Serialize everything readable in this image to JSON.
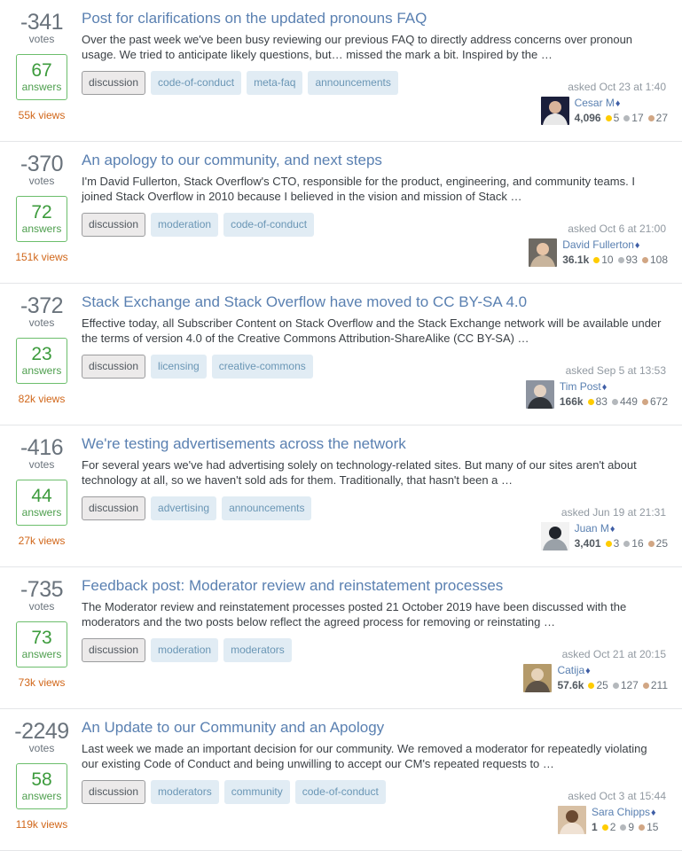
{
  "labels": {
    "votes": "votes",
    "answers": "answers",
    "asked_prefix": "asked",
    "mod_diamond": "♦"
  },
  "questions": [
    {
      "votes": "-341",
      "answers": "67",
      "views": "55k views",
      "title": "Post for clarifications on the updated pronouns FAQ",
      "excerpt": "Over the past week we've been busy reviewing our previous FAQ to directly address concerns over pronoun usage. We tried to anticipate likely questions, but… missed the mark a bit. Inspired by the …",
      "tags": [
        {
          "name": "discussion",
          "style": "required"
        },
        {
          "name": "code-of-conduct",
          "style": "normal"
        },
        {
          "name": "meta-faq",
          "style": "normal"
        },
        {
          "name": "announcements",
          "style": "normal"
        }
      ],
      "asked": "asked Oct 23 at 1:40",
      "user": {
        "name": "Cesar M",
        "moderator": true,
        "reputation": "4,096",
        "gold": "5",
        "silver": "17",
        "bronze": "27",
        "avatar_colors": [
          "#1b1f3b",
          "#d9b49b",
          "#e8e8e8"
        ]
      }
    },
    {
      "votes": "-370",
      "answers": "72",
      "views": "151k views",
      "title": "An apology to our community, and next steps",
      "excerpt": "I'm David Fullerton, Stack Overflow's CTO, responsible for the product, engineering, and community teams. I joined Stack Overflow in 2010 because I believed in the vision and mission of Stack …",
      "tags": [
        {
          "name": "discussion",
          "style": "required"
        },
        {
          "name": "moderation",
          "style": "normal"
        },
        {
          "name": "code-of-conduct",
          "style": "normal"
        }
      ],
      "asked": "asked Oct 6 at 21:00",
      "user": {
        "name": "David Fullerton",
        "moderator": true,
        "reputation": "36.1k",
        "gold": "10",
        "silver": "93",
        "bronze": "108",
        "avatar_colors": [
          "#6e6a63",
          "#e7c4a6",
          "#c8b49c"
        ]
      }
    },
    {
      "votes": "-372",
      "answers": "23",
      "views": "82k views",
      "title": "Stack Exchange and Stack Overflow have moved to CC BY-SA 4.0",
      "excerpt": "Effective today, all Subscriber Content on Stack Overflow and the Stack Exchange network will be available under the terms of version 4.0 of the Creative Commons Attribution-ShareAlike (CC BY-SA) …",
      "tags": [
        {
          "name": "discussion",
          "style": "required"
        },
        {
          "name": "licensing",
          "style": "normal"
        },
        {
          "name": "creative-commons",
          "style": "normal"
        }
      ],
      "asked": "asked Sep 5 at 13:53",
      "user": {
        "name": "Tim Post",
        "moderator": true,
        "reputation": "166k",
        "gold": "83",
        "silver": "449",
        "bronze": "672",
        "avatar_colors": [
          "#8d94a0",
          "#e4d2c2",
          "#2f3338"
        ]
      }
    },
    {
      "votes": "-416",
      "answers": "44",
      "views": "27k views",
      "title": "We're testing advertisements across the network",
      "excerpt": "For several years we've had advertising solely on technology-related sites. But many of our sites aren't about technology at all, so we haven't sold ads for them. Traditionally, that hasn't been a …",
      "tags": [
        {
          "name": "discussion",
          "style": "required"
        },
        {
          "name": "advertising",
          "style": "normal"
        },
        {
          "name": "announcements",
          "style": "normal"
        }
      ],
      "asked": "asked Jun 19 at 21:31",
      "user": {
        "name": "Juan M",
        "moderator": true,
        "reputation": "3,401",
        "gold": "3",
        "silver": "16",
        "bronze": "25",
        "avatar_colors": [
          "#f2f2f2",
          "#20242b",
          "#9aa1a8"
        ]
      }
    },
    {
      "votes": "-735",
      "answers": "73",
      "views": "73k views",
      "title": "Feedback post: Moderator review and reinstatement processes",
      "excerpt": "The Moderator review and reinstatement processes posted 21 October 2019 have been discussed with the moderators and the two posts below reflect the agreed process for removing or reinstating …",
      "tags": [
        {
          "name": "discussion",
          "style": "required"
        },
        {
          "name": "moderation",
          "style": "normal"
        },
        {
          "name": "moderators",
          "style": "normal"
        }
      ],
      "asked": "asked Oct 21 at 20:15",
      "user": {
        "name": "Catija",
        "moderator": true,
        "reputation": "57.6k",
        "gold": "25",
        "silver": "127",
        "bronze": "211",
        "avatar_colors": [
          "#b49a6a",
          "#e6d3ba",
          "#5e5347"
        ]
      }
    },
    {
      "votes": "-2249",
      "answers": "58",
      "views": "119k views",
      "title": "An Update to our Community and an Apology",
      "excerpt": "Last week we made an important decision for our community. We removed a moderator for repeatedly violating our existing Code of Conduct and being unwilling to accept our CM's repeated requests to …",
      "tags": [
        {
          "name": "discussion",
          "style": "required"
        },
        {
          "name": "moderators",
          "style": "normal"
        },
        {
          "name": "community",
          "style": "normal"
        },
        {
          "name": "code-of-conduct",
          "style": "normal"
        }
      ],
      "asked": "asked Oct 3 at 15:44",
      "user": {
        "name": "Sara Chipps",
        "moderator": true,
        "reputation": "1",
        "gold": "2",
        "silver": "9",
        "bronze": "15",
        "avatar_colors": [
          "#d8c0a4",
          "#6b4a32",
          "#f0e2d4"
        ]
      }
    }
  ]
}
